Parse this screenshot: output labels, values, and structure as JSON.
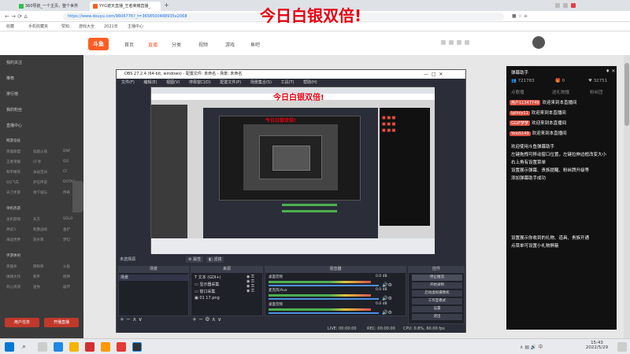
{
  "browser": {
    "tabs": [
      {
        "label": "360导航_一个主页，整个世界"
      },
      {
        "label": "YYG遮天直播_王者荣耀直播_"
      }
    ],
    "new_tab": "+",
    "url": "https://www.douyu.com/9606776?_t=3658500488935e2068",
    "bookmarks": [
      "收藏",
      "手机收藏夹",
      "赞知",
      "游戏大全",
      "2021年",
      "主播中心"
    ]
  },
  "overlay_title": "今日白银双倍!",
  "douyu": {
    "nav": [
      "首页",
      "直播",
      "分类",
      "视频",
      "游戏",
      "鱼吧"
    ],
    "logo_text": "斗鱼",
    "sidebar": {
      "items": [
        "我的关注",
        "推荐",
        "排行榜",
        "我的粉丝",
        "直播中心"
      ],
      "section1": "网游竞技",
      "section2": "单机热游",
      "section3": "手游休闲",
      "categories1": [
        [
          "英雄联盟",
          "穿越火线",
          "DNF"
        ],
        [
          "王者荣耀",
          "CF手",
          "QQ"
        ],
        [
          "和平精英",
          "永劫无间",
          "CF"
        ],
        [
          "QQ飞车",
          "炉石传说",
          "DOTA2"
        ],
        [
          "天刀手游",
          "地下城与",
          "传奇"
        ]
      ],
      "categories2": [
        [
          "主机游戏",
          "东方",
          "SOLO"
        ],
        [
          "神武3",
          "刺激战场",
          "金铲"
        ],
        [
          "海战世界",
          "逆水寒",
          "梦幻"
        ]
      ],
      "categories3": [
        [
          "英雄杀",
          "阴阳师",
          "斗鱼"
        ],
        [
          "球球大作",
          "和平",
          "原神"
        ],
        [
          "开心消消",
          "迷你",
          "崩坏"
        ]
      ],
      "bottom_buttons": [
        "用户任务",
        "开播直播"
      ]
    }
  },
  "obs": {
    "title": "OBS 27.2.4 (64-bit, windows) - 配置文件: 未命名 - 场景: 未命名",
    "menu": [
      "文件(F)",
      "编辑(E)",
      "视图(V)",
      "停靠窗口(D)",
      "配置文件(P)",
      "场景集合(S)",
      "工具(T)",
      "帮助(H)"
    ],
    "preview_title": "今日白银双倍!",
    "scene_label": "未选择源",
    "scene_buttons": [
      "属性",
      "滤镜"
    ],
    "docks": {
      "scenes": {
        "header": "场景",
        "items": [
          "场景"
        ]
      },
      "sources": {
        "header": "来源",
        "items": [
          "文本 (GDI+)",
          "显示器采集",
          "窗口采集",
          "01 17.png"
        ]
      },
      "mixer": {
        "header": "混音器",
        "channels": [
          {
            "name": "桌面音频",
            "level": "0.0 dB"
          },
          {
            "name": "麦克风/Aux",
            "level": "0.0 dB"
          },
          {
            "name": "桌面音频",
            "level": "0.0 dB"
          }
        ]
      },
      "controls": {
        "header": "控件",
        "buttons": [
          "停止推流",
          "开始录制",
          "启动虚拟摄像机",
          "工作室模式",
          "设置",
          "退出"
        ]
      }
    },
    "status": {
      "live": "LIVE: 00:00:00",
      "rec": "REC: 00:00:00",
      "cpu": "CPU: 0.8%, 60.00 fps"
    }
  },
  "danmaku_panel": {
    "title": "弹幕助手",
    "stats": [
      "721783",
      "0",
      "32751"
    ],
    "tabs": [
      "点歌播",
      "送礼物播",
      "粉丝团"
    ],
    "messages": [
      {
        "user": "用户11347749",
        "text": "欢迎来到本直播间"
      },
      {
        "user": "tplinly11",
        "text": "欢迎来到本直播间"
      },
      {
        "user": "GGIF梦梦",
        "text": "欢迎来到本直播间"
      },
      {
        "user": "Yolo5149",
        "text": "欢迎来到本直播间"
      }
    ],
    "help_lines": [
      "欢迎使用斗鱼弹幕助手",
      "左键拖拽可移动窗口位置，左键拉伸边框改变大小",
      "右上角有设置菜单",
      "设置展示弹幕、贵族提醒、粉丝牌升级等",
      "添加弹幕助手成功"
    ],
    "footer_lines": [
      "设置展示你收到的礼物、道具、贵族开通",
      "点菜单可设置小礼物屏蔽"
    ]
  },
  "taskbar": {
    "time": "15:43",
    "date": "2022/5/29"
  },
  "colors": {
    "brand_orange": "#ff5d23",
    "overlay_red": "#e60012",
    "obs_dark": "#2b2e38"
  }
}
